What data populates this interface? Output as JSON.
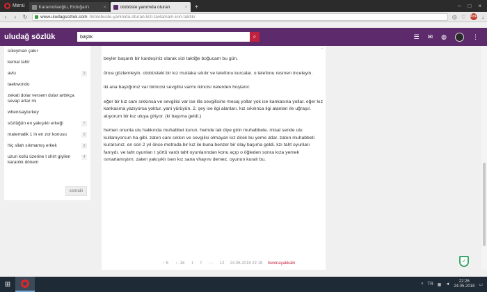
{
  "browser": {
    "menu_label": "Menü",
    "tabs": [
      {
        "title": "Karamollaoğlu, Erdoğan'ı",
        "active": false
      },
      {
        "title": "otobüste yanımda oturan",
        "active": true
      }
    ],
    "new_tab": "+",
    "url_domain": "www.uludagsozluk.com",
    "url_path": "/k/otobuste-yanimda-oturan-kizi-tavlamam-icin-taktik/",
    "ext_badge": "ABP"
  },
  "site": {
    "logo": "uludağ sözlük",
    "search": {
      "value": "başlık"
    }
  },
  "sidebar": {
    "items": [
      {
        "label": "süleyman çakır",
        "count": ""
      },
      {
        "label": "kemal tahir",
        "count": ""
      },
      {
        "label": "avlu",
        "count": "3"
      },
      {
        "label": "taekwondo",
        "count": ""
      },
      {
        "label": "zekati dolar versem dolar arttıkça sevap artar mı",
        "count": ""
      },
      {
        "label": "whenisayturkey",
        "count": ""
      },
      {
        "label": "sözlüğün en yakışıklı erkeği",
        "count": "7"
      },
      {
        "label": "matematik 1 in en zor konusu",
        "count": "3"
      },
      {
        "label": "hiç silah sıkmamış erkek",
        "count": "3"
      },
      {
        "label": "uzun kollu üzerine t shirt giyilen karanlık dönem",
        "count": "4"
      }
    ],
    "more_label": "sonraki"
  },
  "entry": {
    "paragraphs": [
      "beyler başarılı bir kardeşiniz olarak sizi taktiğe boğucam bu gün.",
      "önce gözlemleyin. otobüsteki bir kız mutlaka sıkılır ve telefonu kurcalar. o telefonu resmen inceleyin.",
      "iki ana başlığımız var birincisi sevgilisi varmı ikincisi nelerden hoşlanır.",
      "eğer bir kız canı sıkkınsa ve sevgilisi var ise illa sevgilisine mesaj yollar yok ise kankasına yollar. eğer kız kankasına yazıyorsa yoktur. yani yürüyün. 2. şey ise ilgi alanları. kız sıkılınca ilgi alanları ile uğraşır. atıyorum bir kız uluya giriyor. (ki başıma geldi.)",
      "hemen onunla ulu hakkında muhabbet kurun. hemde lak diye girin muhabbete. misal sende ulu kullanıyorsun ha gibi. zaten canı sıkkın ve sevgilisi olmayan kız direk bu yeme atlar. zaten muhabbeti kurarsınız. en son 2 yıl önce metroda bir kız ile buna benzer bir olay başıma geldi. kzı taht oyunları fanıydı. ve taht oyunları t şörtü vardı taht oyunlarından konu açıp o öğleden sonra kıza yemek ısmarlamıştım. zaten yakışıklı isen kız sana vhayırv demez. oyunun kuralı bu."
    ],
    "footer": {
      "upvotes": "8",
      "downvotes": "-18",
      "entry_no": "12",
      "date": "24.05.2018 22:18",
      "author": "betonayakkabi"
    }
  },
  "taskbar": {
    "lang": "TR",
    "time": "22:26",
    "date": "24.05.2018"
  },
  "colors": {
    "header": "#5d2b6b",
    "accent": "#c0213e"
  }
}
